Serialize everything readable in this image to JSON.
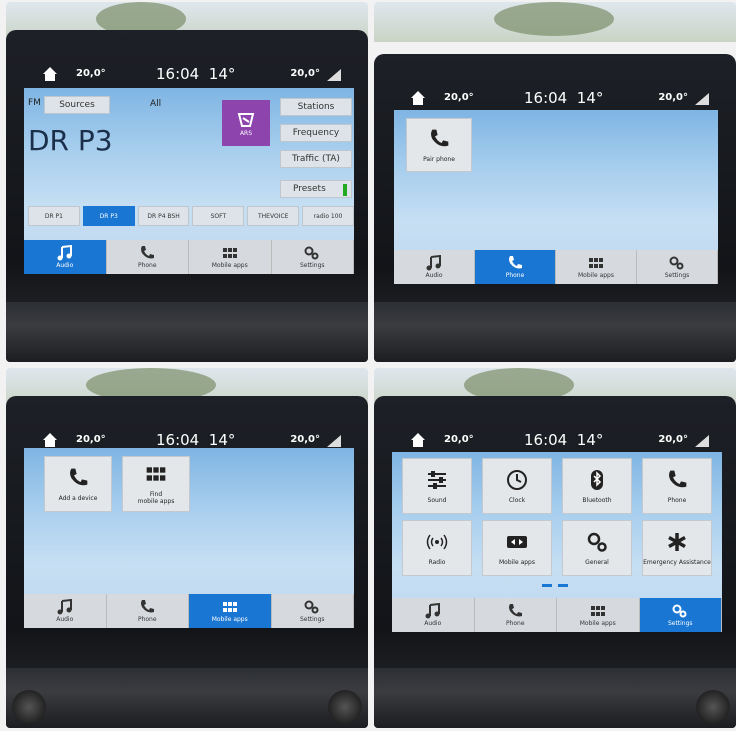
{
  "status": {
    "temp_left": "20,0°",
    "clock": "16:04",
    "outside": "14°",
    "temp_right": "20,0°"
  },
  "nav": {
    "audio": "Audio",
    "phone": "Phone",
    "mobile_apps": "Mobile apps",
    "settings": "Settings"
  },
  "radio": {
    "band": "FM",
    "sources": "Sources",
    "all": "All",
    "station_name": "DR P3",
    "logo_text": "ARS",
    "stations": "Stations",
    "frequency": "Frequency",
    "traffic": "Traffic (TA)",
    "presets": "Presets",
    "preset_list": [
      "DR P1",
      "DR P3",
      "DR P4 BSH",
      "SOFT",
      "THEVOICE",
      "radio 100"
    ]
  },
  "phone_screen": {
    "pair_phone": "Pair phone"
  },
  "apps_screen": {
    "add_device": "Add a device",
    "find_apps_line1": "Find",
    "find_apps_line2": "mobile apps"
  },
  "settings_screen": {
    "tiles": [
      "Sound",
      "Clock",
      "Bluetooth",
      "Phone",
      "Radio",
      "Mobile apps",
      "General",
      "Emergency Assistance"
    ]
  },
  "colors": {
    "accent": "#1976d2",
    "screen_bg": "#a9cfee"
  }
}
